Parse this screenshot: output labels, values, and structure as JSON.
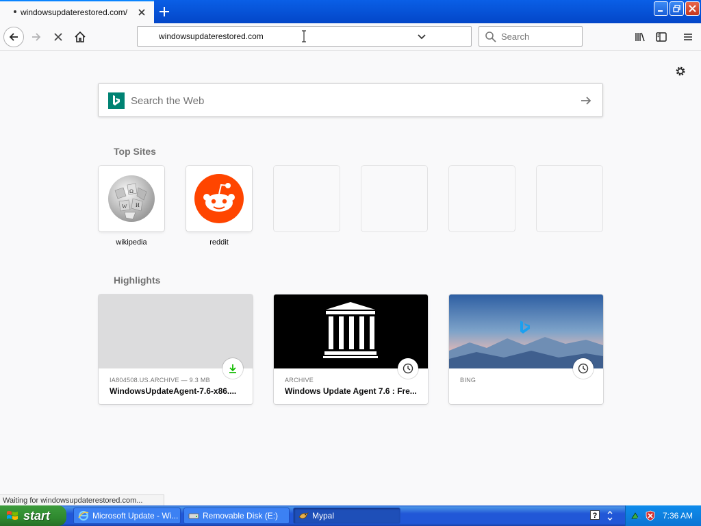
{
  "browser": {
    "tab": {
      "title": "windowsupdaterestored.com/"
    },
    "address": {
      "url": "windowsupdaterestored.com"
    },
    "search": {
      "placeholder": "Search"
    }
  },
  "newtab": {
    "web_search_placeholder": "Search the Web",
    "top_sites_title": "Top Sites",
    "top_sites": [
      {
        "label": "wikipedia",
        "icon": "wikipedia-globe-icon"
      },
      {
        "label": "reddit",
        "icon": "reddit-alien-icon"
      }
    ],
    "highlights_title": "Highlights",
    "highlights": [
      {
        "source": "IA804508.US.ARCHIVE — 9.3 MB",
        "title": "WindowsUpdateAgent-7.6-x86....",
        "badge": "download-icon"
      },
      {
        "source": "ARCHIVE",
        "title": "Windows Update Agent 7.6 : Fre...",
        "badge": "clock-icon"
      },
      {
        "source": "BING",
        "title": "",
        "badge": "clock-icon"
      }
    ]
  },
  "status": {
    "text": "Waiting for windowsupdaterestored.com..."
  },
  "taskbar": {
    "start_label": "start",
    "items": [
      {
        "label": "Microsoft Update - Wi..."
      },
      {
        "label": "Removable Disk (E:)"
      },
      {
        "label": "Mypal"
      }
    ],
    "clock": "7:36 AM"
  },
  "colors": {
    "accent": "#0a84ff",
    "bing_green": "#008373",
    "reddit": "#ff4500"
  }
}
